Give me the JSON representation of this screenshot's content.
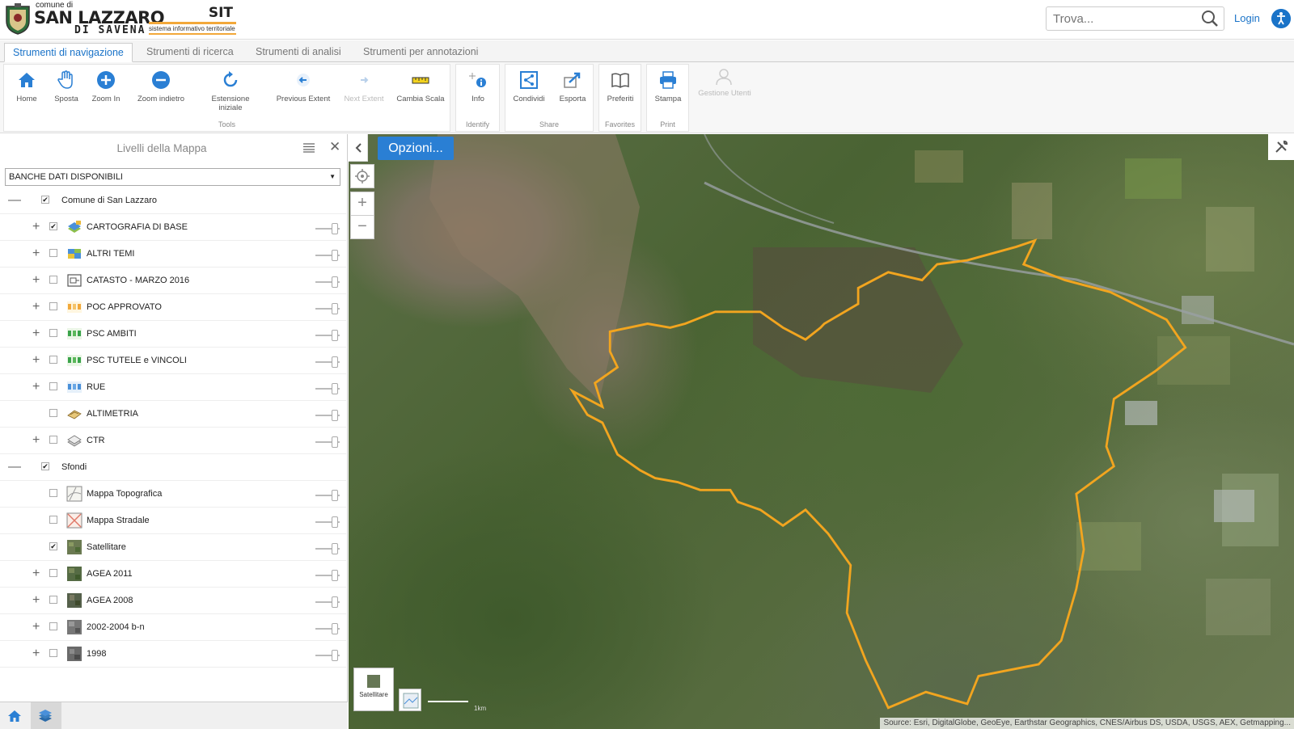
{
  "header": {
    "logo_small": "comune di",
    "logo_main": "SAN LAZZARO",
    "logo_sub": "DI SAVENA",
    "sit_title": "SIT",
    "sit_subtitle": "sistema informativo territoriale",
    "search_placeholder": "Trova...",
    "login_label": "Login"
  },
  "tabs": [
    {
      "label": "Strumenti di navigazione",
      "active": true
    },
    {
      "label": "Strumenti di ricerca",
      "active": false
    },
    {
      "label": "Strumenti di analisi",
      "active": false
    },
    {
      "label": "Strumenti per annotazioni",
      "active": false
    }
  ],
  "ribbon": {
    "groups": {
      "tools": "Tools",
      "identify": "Identify",
      "share": "Share",
      "favorites": "Favorites",
      "print": "Print"
    },
    "tools": {
      "home": "Home",
      "sposta": "Sposta",
      "zoom_in": "Zoom In",
      "zoom_out": "Zoom indietro",
      "extent_initial_1": "Estensione",
      "extent_initial_2": "iniziale",
      "previous_extent": "Previous Extent",
      "next_extent": "Next Extent",
      "change_scale": "Cambia Scala",
      "info": "Info",
      "condividi": "Condividi",
      "esporta": "Esporta",
      "preferiti": "Preferiti",
      "stampa": "Stampa",
      "gestione_utenti": "Gestione Utenti"
    }
  },
  "panel": {
    "title": "Livelli della Mappa",
    "dropdown_value": "BANCHE DATI DISPONIBILI",
    "groups": [
      {
        "label": "Comune di San Lazzaro",
        "checked": true,
        "layers": [
          {
            "label": "CARTOGRAFIA DI BASE",
            "checked": true,
            "expandable": true
          },
          {
            "label": "ALTRI TEMI",
            "checked": false,
            "expandable": true
          },
          {
            "label": "CATASTO - MARZO 2016",
            "checked": false,
            "expandable": true
          },
          {
            "label": "POC APPROVATO",
            "checked": false,
            "expandable": true
          },
          {
            "label": "PSC AMBITI",
            "checked": false,
            "expandable": true
          },
          {
            "label": "PSC TUTELE e VINCOLI",
            "checked": false,
            "expandable": true
          },
          {
            "label": "RUE",
            "checked": false,
            "expandable": true
          },
          {
            "label": "ALTIMETRIA",
            "checked": false,
            "expandable": false
          },
          {
            "label": "CTR",
            "checked": false,
            "expandable": true
          }
        ]
      },
      {
        "label": "Sfondi",
        "checked": true,
        "layers": [
          {
            "label": "Mappa Topografica",
            "checked": false,
            "expandable": false
          },
          {
            "label": "Mappa Stradale",
            "checked": false,
            "expandable": false
          },
          {
            "label": "Satellitare",
            "checked": true,
            "expandable": false
          },
          {
            "label": "AGEA 2011",
            "checked": false,
            "expandable": true
          },
          {
            "label": "AGEA 2008",
            "checked": false,
            "expandable": true
          },
          {
            "label": "2002-2004 b-n",
            "checked": false,
            "expandable": true
          },
          {
            "label": "1998",
            "checked": false,
            "expandable": true
          }
        ]
      }
    ]
  },
  "map": {
    "options_button": "Opzioni...",
    "basemap_label": "Satellitare",
    "scale_label": "1km",
    "attribution": "Source: Esri, DigitalGlobe, GeoEye, Earthstar Geographics, CNES/Airbus DS, USDA, USGS, AEX, Getmapping...",
    "boundary_color": "#f2a51f"
  },
  "colors": {
    "accent": "#1a73c8",
    "button_blue": "#2a7fd4",
    "logo_orange": "#f2a83a"
  }
}
